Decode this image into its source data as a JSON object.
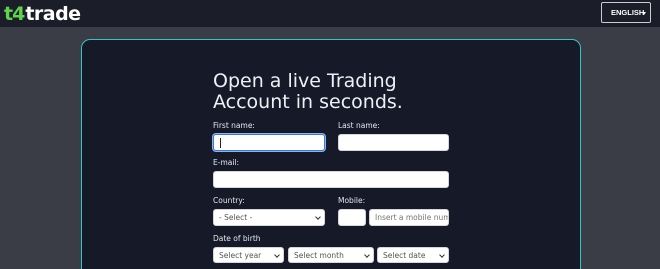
{
  "header": {
    "logo_mark": "t4",
    "logo_text": "trade",
    "language_label": "ENGLISH"
  },
  "form": {
    "title": "Open a live Trading Account in seconds.",
    "first_name_label": "First name:",
    "last_name_label": "Last name:",
    "email_label": "E-mail:",
    "country_label": "Country:",
    "country_value": "- Select -",
    "mobile_label": "Mobile:",
    "mobile_placeholder": "Insert a mobile number",
    "dob_label": "Date of birth",
    "year_value": "Select year",
    "month_value": "Select month",
    "date_value": "Select date"
  }
}
